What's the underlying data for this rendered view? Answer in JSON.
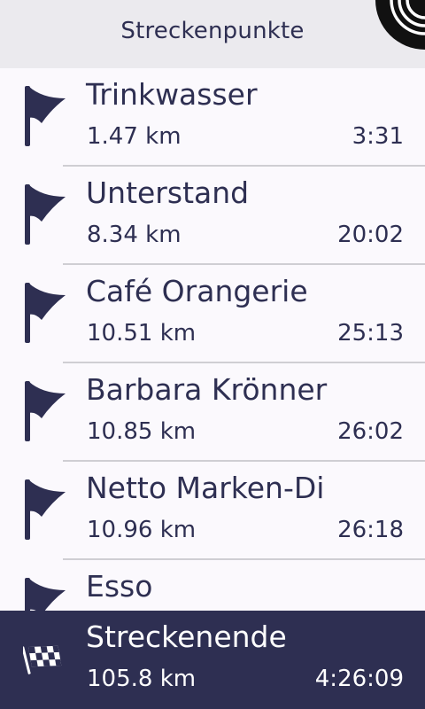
{
  "header": {
    "title": "Streckenpunkte"
  },
  "waypoints": [
    {
      "name": "Trinkwasser",
      "distance": "1.47 km",
      "time": "3:31"
    },
    {
      "name": "Unterstand",
      "distance": "8.34 km",
      "time": "20:02"
    },
    {
      "name": "Café Orangerie",
      "distance": "10.51 km",
      "time": "25:13"
    },
    {
      "name": "Barbara Krönner",
      "distance": "10.85 km",
      "time": "26:02"
    },
    {
      "name": "Netto Marken-Di",
      "distance": "10.96 km",
      "time": "26:18"
    },
    {
      "name": "Esso",
      "distance": "",
      "time": ""
    }
  ],
  "route_end": {
    "name": "Streckenende",
    "distance": "105.8 km",
    "time": "4:26:09"
  },
  "colors": {
    "accent": "#2e2f52",
    "header_bg": "#ebeaee",
    "list_bg": "#fbf9fd",
    "divider": "#cfced3"
  },
  "icons": {
    "waypoint": "flag-icon",
    "route_end": "checkered-flag-icon",
    "header_corner": "gps-signal-icon"
  }
}
